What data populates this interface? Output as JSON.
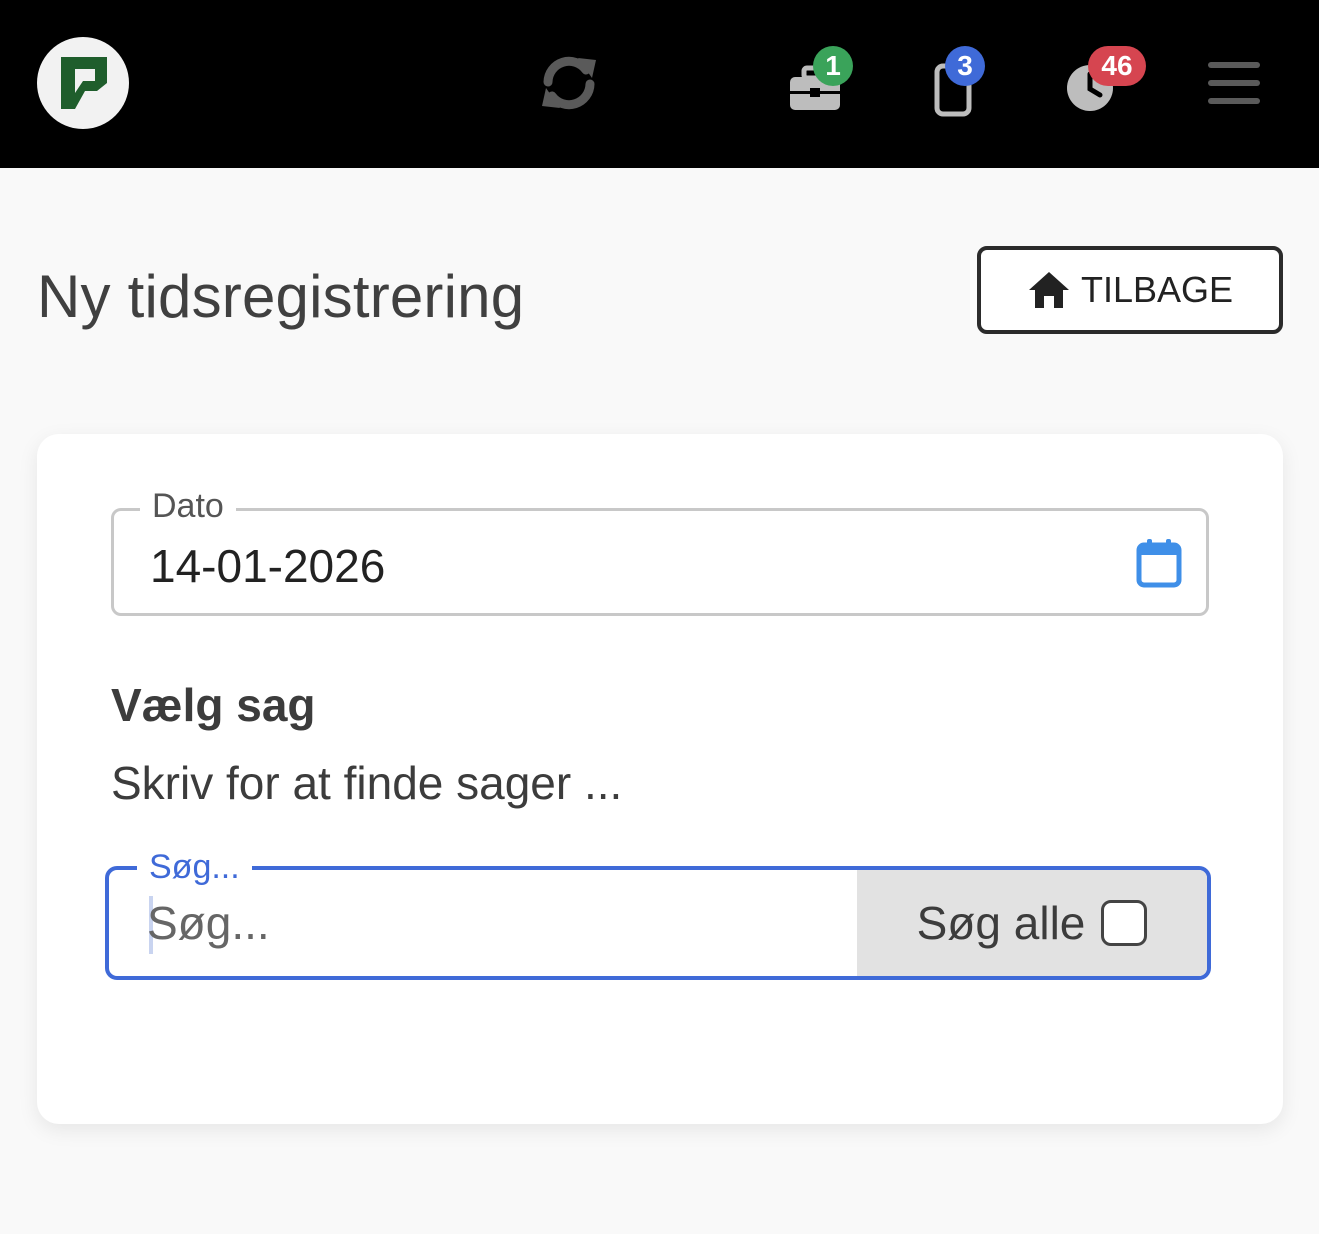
{
  "topbar": {
    "badges": {
      "tasks": "1",
      "devices": "3",
      "time": "46"
    },
    "icons": {
      "logo": "company-logo",
      "sync": "sync-icon",
      "tasks": "briefcase-icon",
      "devices": "phone-icon",
      "time": "clock-icon",
      "menu": "hamburger-menu-icon"
    }
  },
  "header": {
    "title": "Ny tidsregistrering",
    "back_label": "TILBAGE"
  },
  "form": {
    "date": {
      "label": "Dato",
      "value": "14-01-2026"
    },
    "case": {
      "title": "Vælg sag",
      "hint": "Skriv for at finde sager ...",
      "search_label": "Søg...",
      "search_placeholder": "Søg...",
      "search_value": "",
      "search_all_label": "Søg alle",
      "search_all_checked": false
    }
  },
  "colors": {
    "topbar": "#000000",
    "accent": "#3f6ad8",
    "badge_green": "#3aa35a",
    "badge_blue": "#3f6ad8",
    "badge_red": "#d64550",
    "logo_green": "#1f5e2c"
  }
}
